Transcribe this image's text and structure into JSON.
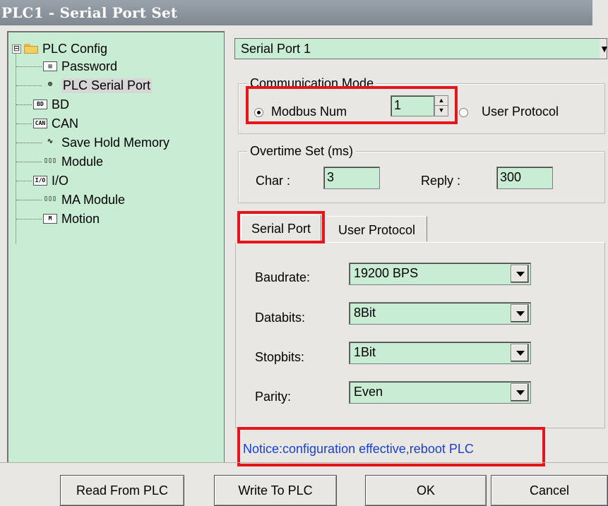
{
  "window": {
    "title": "PLC1 - Serial Port  Set"
  },
  "tree": {
    "root_label": "PLC Config",
    "expander": "⊟",
    "items": [
      {
        "label": "Password",
        "icon_text": "▤"
      },
      {
        "label": "PLC Serial Port",
        "icon_text": "⊕"
      },
      {
        "label": "BD",
        "icon_text": "BD"
      },
      {
        "label": "CAN",
        "icon_text": "CAN"
      },
      {
        "label": "Save Hold Memory",
        "icon_text": "∿"
      },
      {
        "label": "Module",
        "icon_text": "▯▯▯"
      },
      {
        "label": "I/O",
        "icon_text": "I/O"
      },
      {
        "label": "MA Module",
        "icon_text": "▯▯▯"
      },
      {
        "label": "Motion",
        "icon_text": "M"
      }
    ]
  },
  "port_select": {
    "value": "Serial Port 1",
    "arrow": "▼"
  },
  "communication_mode": {
    "title": "Communication Mode",
    "modbus_label": "Modbus Num",
    "modbus_value": "1",
    "user_protocol_label": "User Protocol",
    "spin_up": "▲",
    "spin_down": "▼"
  },
  "overtime": {
    "title": "Overtime Set (ms)",
    "char_label": "Char :",
    "char_value": "3",
    "reply_label": "Reply :",
    "reply_value": "300"
  },
  "tabs": {
    "serial_port": "Serial Port",
    "user_protocol": "User Protocol"
  },
  "serial_settings": {
    "baudrate_label": "Baudrate:",
    "baudrate_value": "19200 BPS",
    "databits_label": "Databits:",
    "databits_value": "8Bit",
    "stopbits_label": "Stopbits:",
    "stopbits_value": "1Bit",
    "parity_label": "Parity:",
    "parity_value": "Even"
  },
  "notice": "Notice:configuration effective,reboot PLC",
  "buttons": {
    "read": "Read From PLC",
    "write": "Write To PLC",
    "ok": "OK",
    "cancel": "Cancel"
  },
  "colors": {
    "field_bg": "#c9ecd4",
    "highlight": "#e4161b",
    "notice": "#1a3fd6"
  }
}
